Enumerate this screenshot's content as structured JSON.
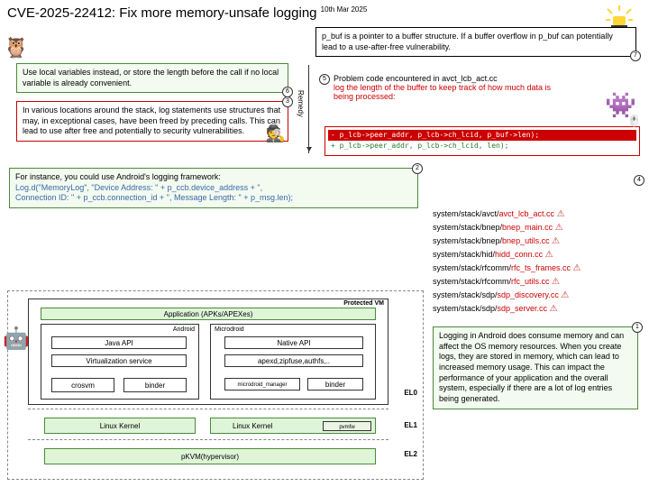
{
  "title": {
    "main": "CVE-2025-22412: Fix more memory-unsafe logging",
    "date": "10th Mar 2025"
  },
  "b7": "p_buf is a pointer to a buffer structure. If a buffer overflow in p_buf can potentially lead to a use-after-free vulnerability.",
  "b6": "Use local variables instead, or store the length before the call if no local variable is already convenient.",
  "b5": {
    "label": "Problem code encountered in avct_lcb_act.cc",
    "red": "log the length of the buffer to keep track of how much data is being processed:"
  },
  "b3": "In various locations around the stack, log statements use structures that may, in exceptional cases, have been freed by preceding calls. This can lead to use after free and potentially to security vulnerabilities.",
  "remedy": "Remedy",
  "b4": {
    "red": "- p_lcb->peer_addr, p_lcb->ch_lcid, p_buf->len);",
    "grn": "+ p_lcb->peer_addr, p_lcb->ch_lcid, len);"
  },
  "b2": {
    "a": "For instance, you could use Android's logging framework:",
    "b": "Log.d(\"MemoryLog\", \"Device Address: \" + p_ccb.device_address + \",",
    "c": "Connection ID: \" + p_ccb.connection_id + \", Message Length: \" + p_msg.len);"
  },
  "files": [
    {
      "p": "system/stack/avct/",
      "f": "avct_lcb_act.cc"
    },
    {
      "p": "system/stack/bnep/",
      "f": "bnep_main.cc"
    },
    {
      "p": "system/stack/bnep/",
      "f": "bnep_utils.cc"
    },
    {
      "p": "system/stack/hid/",
      "f": "hidd_conn.cc"
    },
    {
      "p": "system/stack/rfcomm/",
      "f": "rfc_ts_frames.cc"
    },
    {
      "p": "system/stack/rfcomm/",
      "f": "rfc_utils.cc"
    },
    {
      "p": "system/stack/sdp/",
      "f": "sdp_discovery.cc"
    },
    {
      "p": "system/stack/sdp/",
      "f": "sdp_server.cc"
    }
  ],
  "b1": "Logging in Android does consume memory and can affect the OS memory resources. When you create logs, they are stored in memory, which can lead to increased memory usage. This can impact the performance of your application and the overall system, especially if there are a lot of log entries being generated.",
  "arch": {
    "pvm": "Protected VM",
    "app": "Application (APKs/APEXes)",
    "android": "Android",
    "micro": "Microdroid",
    "java": "Java API",
    "virt": "Virtualization  service",
    "crosvm": "crosvm",
    "binder": "binder",
    "native": "Native API",
    "apexd": "apexd,zipfuse,authfs,..",
    "mgr": "microdroid_manager",
    "lk": "Linux Kernel",
    "pvmfw": "pvmfw",
    "pkvm": "pKVM(hypervisor)",
    "el0": "EL0",
    "el1": "EL1",
    "el2": "EL2"
  }
}
